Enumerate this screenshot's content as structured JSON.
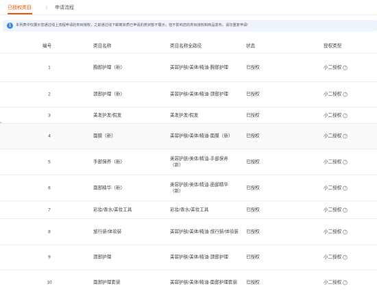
{
  "tabs": {
    "authorized_label": "已授权类目",
    "separator": "|",
    "apply_label": "申请流程"
  },
  "notice": {
    "text": "本列表中仅展示您通过线上流程申请的类目授权，之前通过线下邮寄资质已申请的类目暂不展示，但不影响您的类目授权和商品发布，请勿重复申请!"
  },
  "table": {
    "headers": {
      "no": "编号",
      "name": "类目名称",
      "path": "类目名称全路径",
      "status": "状态",
      "auth_type": "授权类型"
    },
    "rows": [
      {
        "no": "1",
        "name": "胸部护理（新）",
        "path": "美容护肤/美体/精油-胸部护理",
        "status": "已授权",
        "auth_type": "小二授权"
      },
      {
        "no": "2",
        "name": "颈部护理（新）",
        "path": "美容护肤/美体/精油-颈部护理",
        "status": "已授权",
        "auth_type": "小二授权"
      },
      {
        "no": "3",
        "name": "美发护发/假发",
        "path": "美发护发/假发",
        "status": "已授权",
        "auth_type": "小二授权"
      },
      {
        "no": "4",
        "name": "面膜（新）",
        "path": "美容护肤/美体/精油-面膜（新）",
        "status": "已授权",
        "auth_type": "小二授权"
      },
      {
        "no": "5",
        "name": "手部保养（新）",
        "path": "美容护肤/美体/精油-手部保养（新）",
        "status": "已授权",
        "auth_type": "小二授权"
      },
      {
        "no": "6",
        "name": "面部精华（新）",
        "path": "美容护肤/美体/精油-面部精华（新）",
        "status": "已授权",
        "auth_type": "小二授权"
      },
      {
        "no": "7",
        "name": "彩妆/香水/美妆工具",
        "path": "彩妆/香水/美妆工具",
        "status": "已授权",
        "auth_type": "小二授权"
      },
      {
        "no": "8",
        "name": "旅行装/体验装",
        "path": "美容护肤/美体/精油-旅行装/体验装",
        "status": "已授权",
        "auth_type": "小二授权"
      },
      {
        "no": "9",
        "name": "颈部护理",
        "path": "美容护肤/美体/精油-颈部护理",
        "status": "已授权",
        "auth_type": "小二授权"
      },
      {
        "no": "10",
        "name": "面部护理套装",
        "path": "美容护肤/美体/精油-面部护理套装",
        "status": "已授权",
        "auth_type": "小二授权"
      }
    ]
  },
  "icons": {
    "notice": "info-icon",
    "help": "question-circle-icon"
  },
  "colors": {
    "accent": "#ff5000",
    "notice_bg": "#eef4fd",
    "info_blue": "#3d85e6"
  }
}
